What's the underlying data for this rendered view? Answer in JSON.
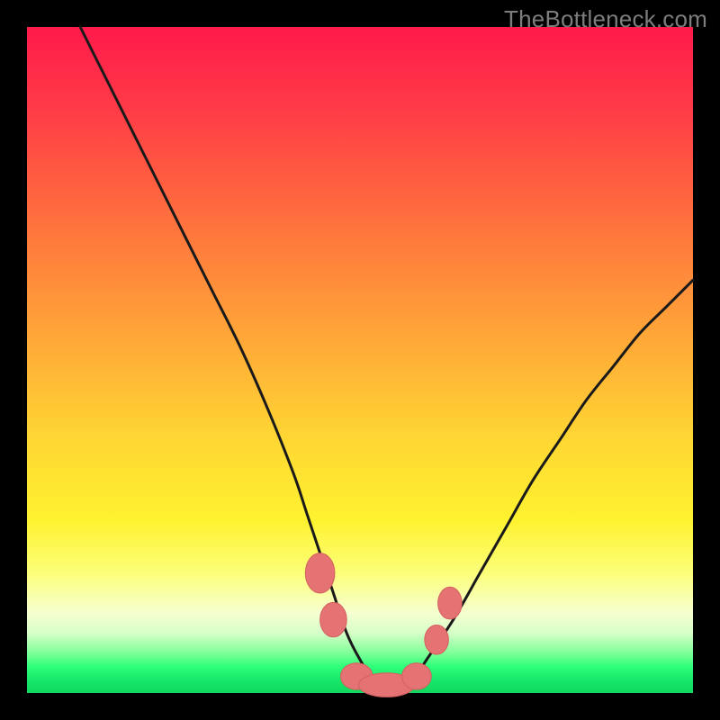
{
  "watermark": "TheBottleneck.com",
  "chart_data": {
    "type": "line",
    "title": "",
    "xlabel": "",
    "ylabel": "",
    "xlim": [
      0,
      100
    ],
    "ylim": [
      0,
      100
    ],
    "series": [
      {
        "name": "curve",
        "x": [
          8,
          12,
          16,
          20,
          24,
          28,
          32,
          36,
          40,
          42,
          44,
          46,
          48,
          50,
          52,
          54,
          56,
          58,
          60,
          64,
          68,
          72,
          76,
          80,
          84,
          88,
          92,
          96,
          100
        ],
        "values": [
          100,
          92,
          84,
          76,
          68,
          60,
          52,
          43,
          33,
          27,
          21,
          15,
          9,
          5,
          2,
          1,
          1,
          2,
          5,
          11,
          18,
          25,
          32,
          38,
          44,
          49,
          54,
          58,
          62
        ]
      }
    ],
    "markers": [
      {
        "name": "left-upper",
        "x": 44.0,
        "y": 18.0,
        "rx": 2.2,
        "ry": 3.0
      },
      {
        "name": "left-lower",
        "x": 46.0,
        "y": 11.0,
        "rx": 2.0,
        "ry": 2.6
      },
      {
        "name": "valley-left",
        "x": 49.5,
        "y": 2.5,
        "rx": 2.4,
        "ry": 2.0
      },
      {
        "name": "valley-mid",
        "x": 54.0,
        "y": 1.2,
        "rx": 4.2,
        "ry": 1.8
      },
      {
        "name": "valley-right",
        "x": 58.5,
        "y": 2.5,
        "rx": 2.2,
        "ry": 2.0
      },
      {
        "name": "right-lower",
        "x": 61.5,
        "y": 8.0,
        "rx": 1.8,
        "ry": 2.2
      },
      {
        "name": "right-upper",
        "x": 63.5,
        "y": 13.5,
        "rx": 1.8,
        "ry": 2.4
      }
    ],
    "colors": {
      "curve_stroke": "#1a1a1a",
      "marker_fill": "#e57373",
      "marker_stroke": "#d45f5f"
    }
  }
}
